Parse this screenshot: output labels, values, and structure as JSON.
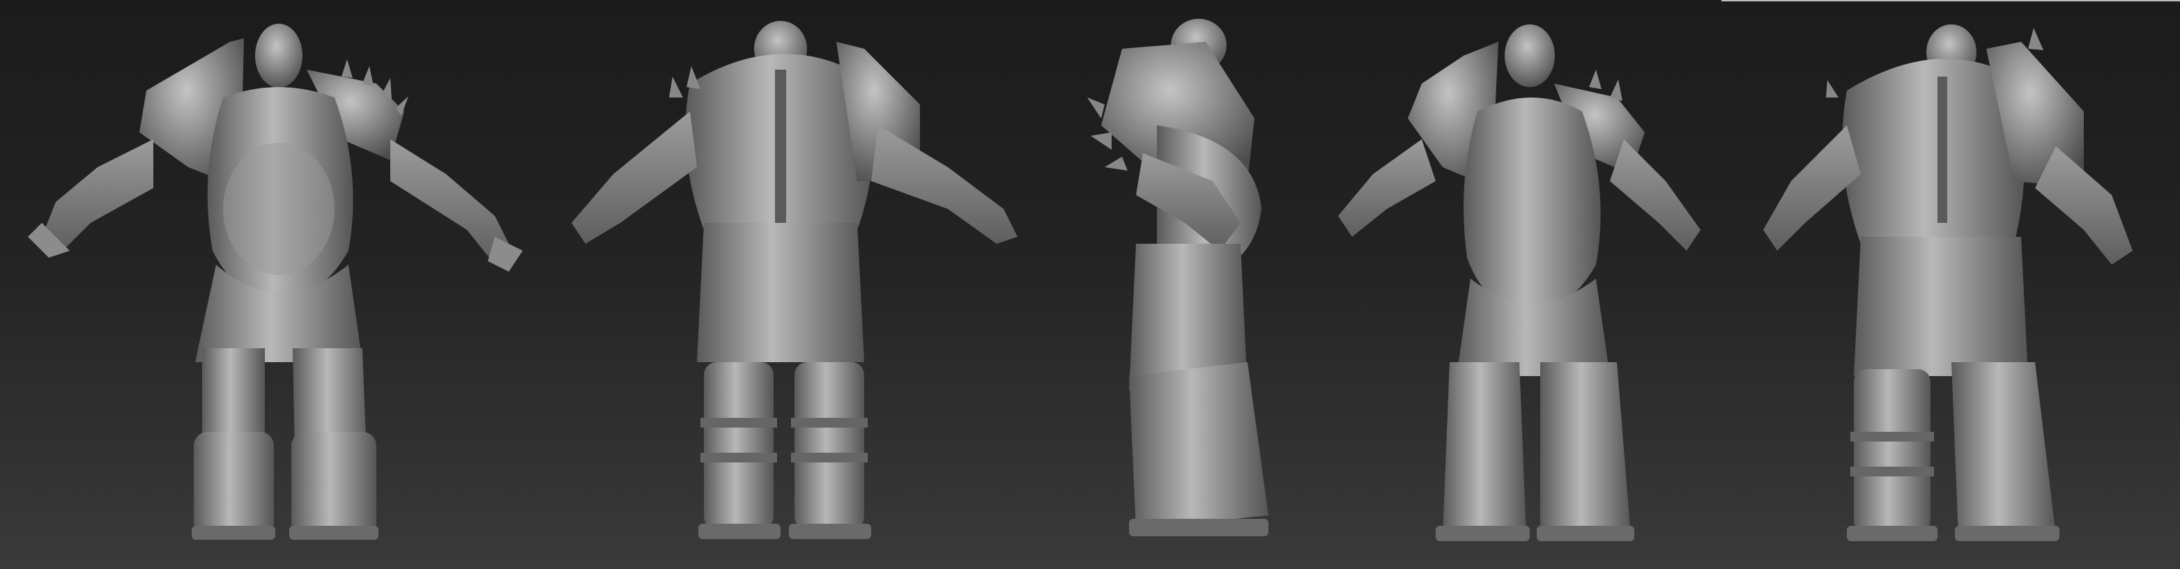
{
  "scene": {
    "description_hidden": "",
    "views": [
      "front",
      "back",
      "side",
      "three-quarter-front",
      "three-quarter-back"
    ],
    "colors": {
      "background_top": "#1b1b1b",
      "background_bottom": "#3a3a3a",
      "sculpt_light": "#b5b5b5",
      "sculpt_mid": "#8a8a8a",
      "sculpt_dark": "#4a4a4a"
    }
  }
}
